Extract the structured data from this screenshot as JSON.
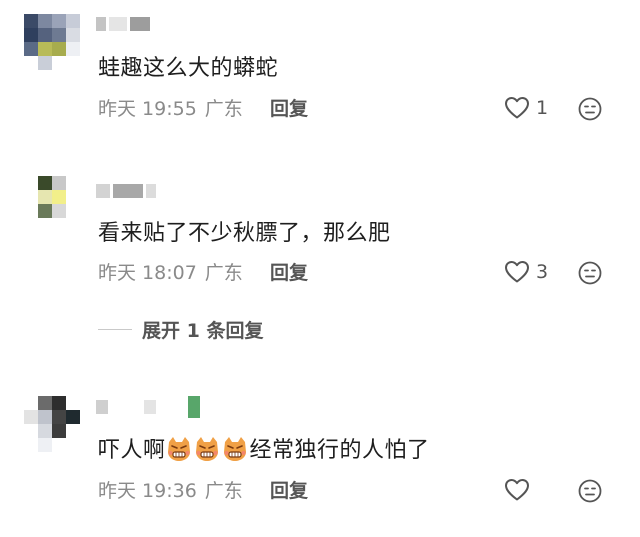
{
  "comments": [
    {
      "text": "蛙趣这么大的蟒蛇",
      "date": "昨天 19:55",
      "location": "广东",
      "reply_label": "回复",
      "like_count": "1"
    },
    {
      "text": "看来贴了不少秋膘了，那么肥",
      "date": "昨天 18:07",
      "location": "广东",
      "reply_label": "回复",
      "like_count": "3",
      "expand_label": "展开 1 条回复"
    },
    {
      "text_after_emoji": "经常独行的人怕了",
      "text_before_emoji": "吓人啊",
      "emoji_name": "angry-cat-emoji",
      "date": "昨天 19:36",
      "location": "广东",
      "reply_label": "回复",
      "like_count": ""
    }
  ],
  "colors": {
    "meta_text": "#8a8a8a",
    "body_text": "#1e1e1e",
    "icon": "#555555",
    "emoji_orange": "#f0a046"
  },
  "icons": {
    "like": "heart-icon",
    "react": "neutral-face-icon"
  }
}
